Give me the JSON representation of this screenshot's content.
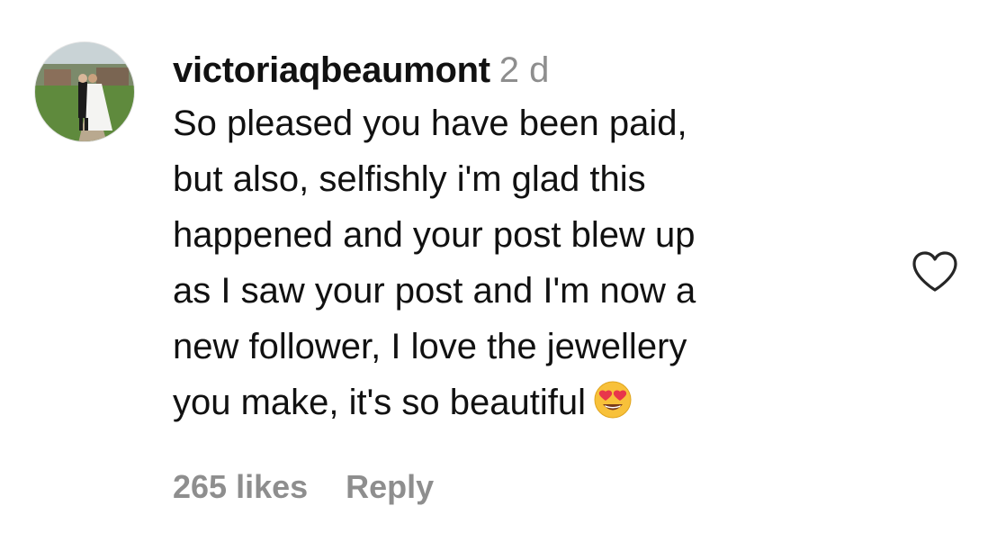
{
  "comment": {
    "username": "victoriaqbeaumont",
    "timestamp": "2 d",
    "lines": [
      "So pleased you have been paid,",
      "but also, selfishly i'm glad this",
      "happened and your post blew up",
      "as I saw your post and I'm now a",
      "new follower, I love the jewellery",
      "you make, it's so beautiful"
    ],
    "emoji": "heart-eyes-emoji",
    "likes_label": "265 likes",
    "reply_label": "Reply",
    "like_icon": "heart-outline-icon"
  },
  "colors": {
    "text": "#111111",
    "muted": "#8e8e8e",
    "background": "#ffffff",
    "heart_stroke": "#262626",
    "emoji_face": "#f8c13a",
    "emoji_hearts": "#e8364b"
  }
}
